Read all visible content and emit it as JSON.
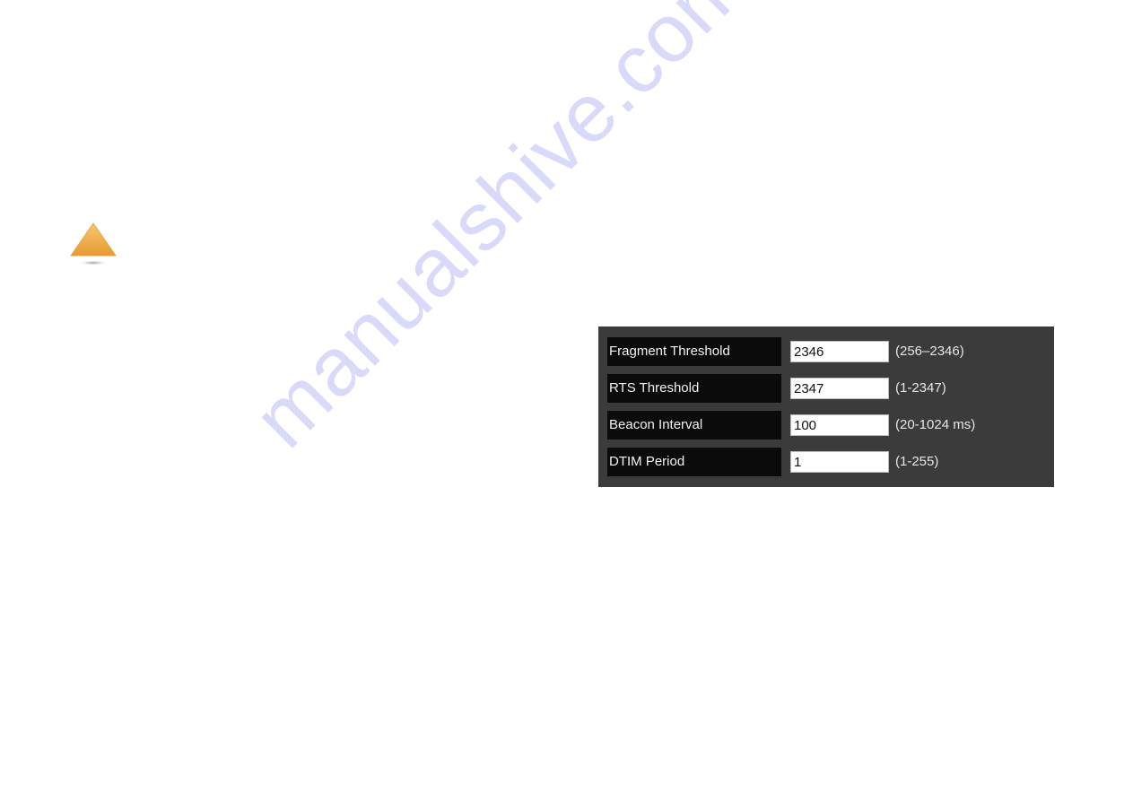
{
  "icons": {
    "warning": "warning-triangle-icon"
  },
  "settings_panel": {
    "rows": [
      {
        "label": "Fragment Threshold",
        "value": "2346",
        "range": "(256–2346)"
      },
      {
        "label": "RTS Threshold",
        "value": "2347",
        "range": "(1-2347)"
      },
      {
        "label": "Beacon Interval",
        "value": "100",
        "range": "(20-1024 ms)"
      },
      {
        "label": "DTIM Period",
        "value": "1",
        "range": "(1-255)"
      }
    ]
  },
  "colors": {
    "panel_bg": "#3b3b3b",
    "label_bg": "#0b0b0b",
    "warning_orange": "#eeaa4a"
  },
  "watermark": {
    "text": "manualshive.com"
  }
}
